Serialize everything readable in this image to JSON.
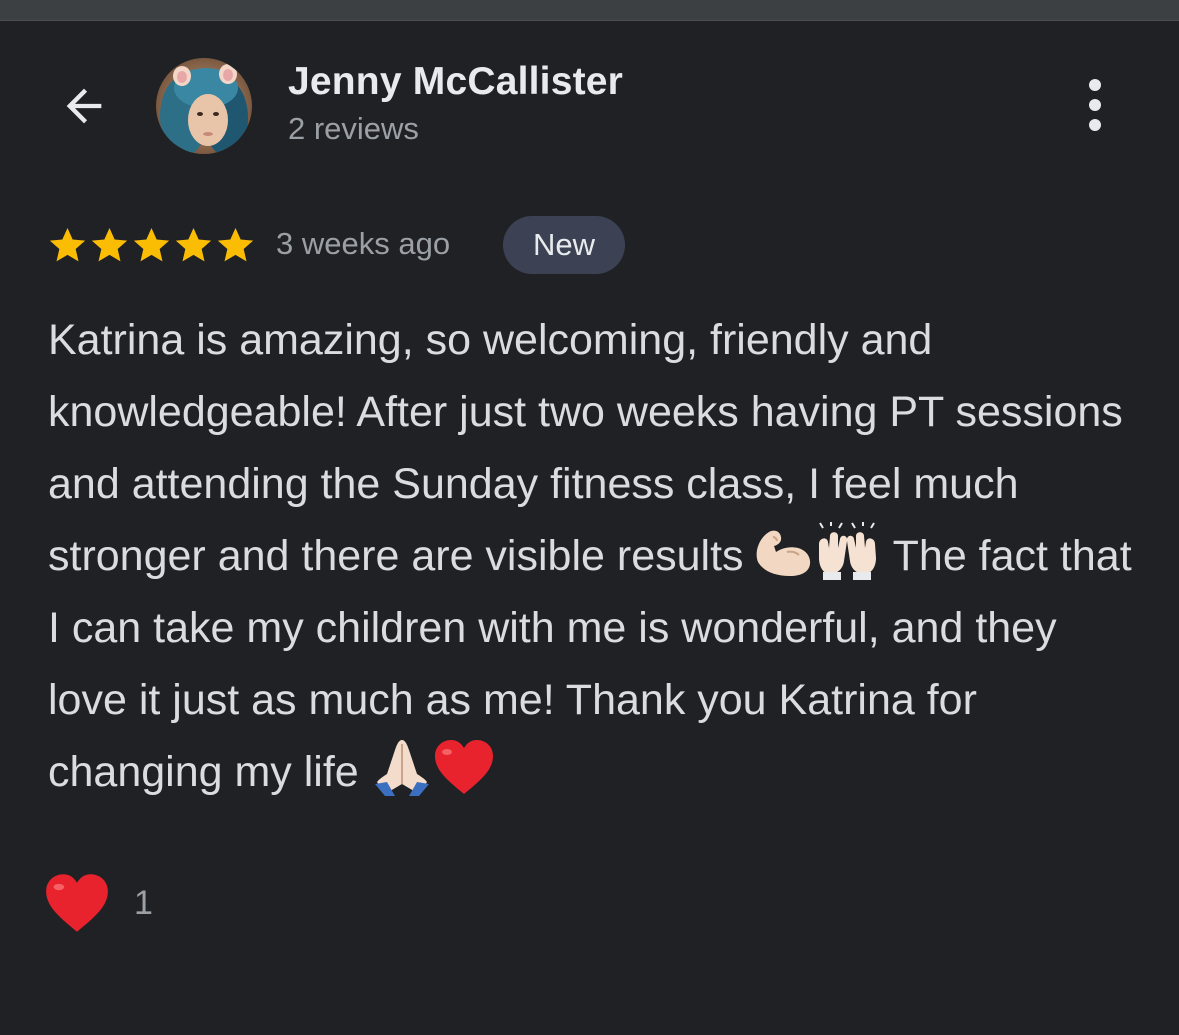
{
  "header": {
    "back_icon": "arrow-left-icon",
    "reviewer_name": "Jenny McCallister",
    "reviews_count": "2 reviews",
    "more_icon": "more-vertical-icon"
  },
  "review": {
    "rating": 5,
    "max_rating": 5,
    "time": "3 weeks ago",
    "badge": "New",
    "text_parts": [
      "Katrina is amazing, so welcoming, friendly and knowledgeable! After just two weeks having PT sessions and attending the Sunday fitness class, I feel much stronger and there are visible results ",
      " The fact that I can take my children with me is wonderful, and they love it just as much as me! Thank you Katrina for changing my life "
    ],
    "emoji_icons": [
      "flexed-biceps-icon",
      "raising-hands-icon",
      "folded-hands-icon",
      "red-heart-icon"
    ]
  },
  "reactions": {
    "icon": "red-heart-icon",
    "count": "1"
  },
  "colors": {
    "background": "#202124",
    "star": "#fbbc04",
    "badge_bg": "#3c4254",
    "heart": "#e8232d",
    "secondary_text": "#9aa0a6"
  }
}
